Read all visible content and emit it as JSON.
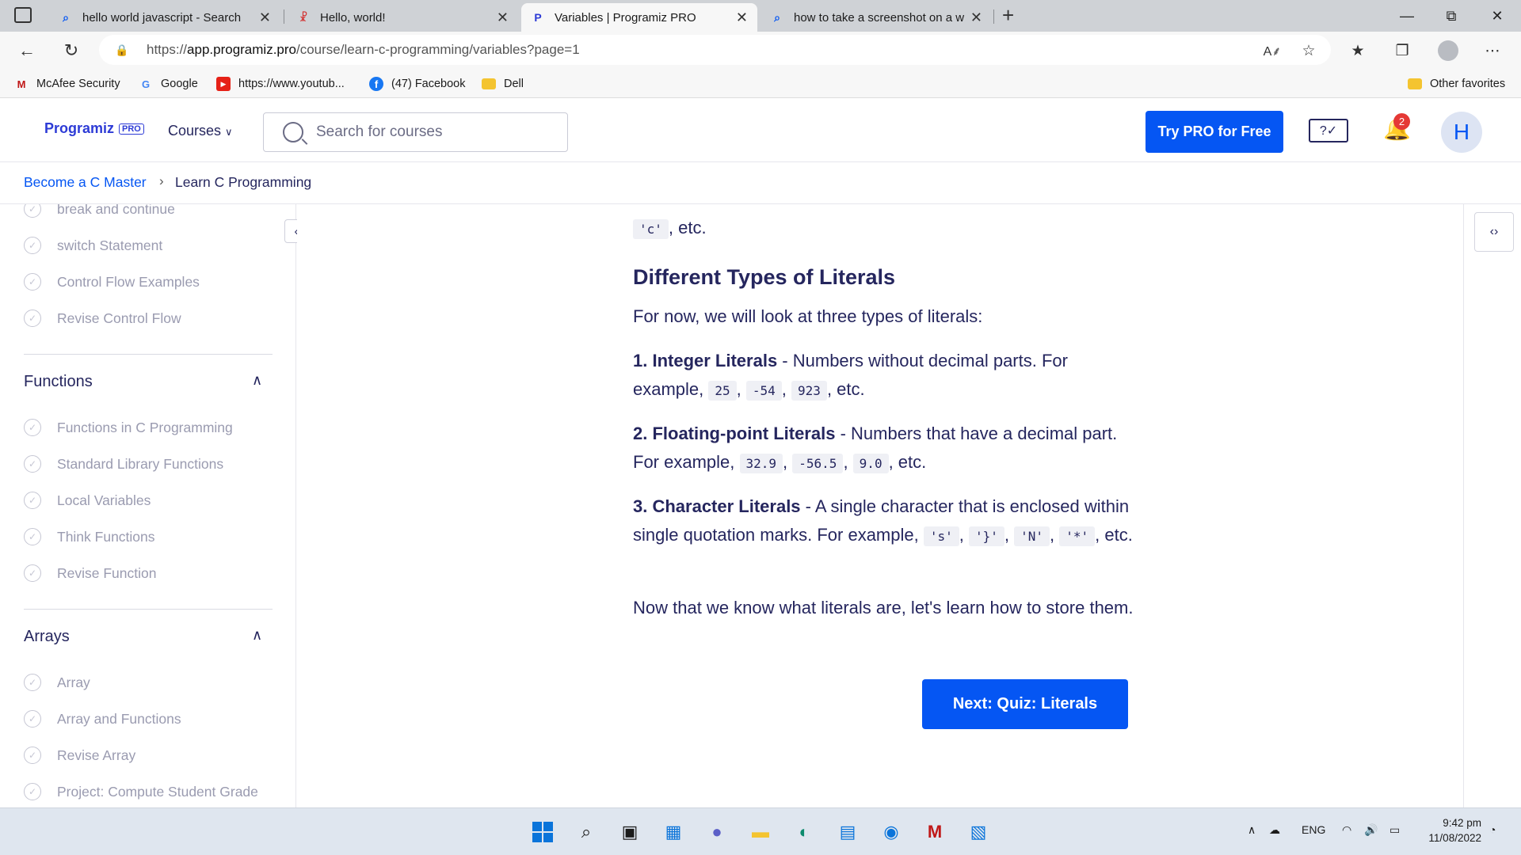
{
  "browser": {
    "tabs": [
      {
        "title": "hello world javascript - Search",
        "icon": "search-icon"
      },
      {
        "title": "Hello, world!",
        "icon": "site-icon"
      },
      {
        "title": "Variables | Programiz PRO",
        "icon": "programiz-icon"
      },
      {
        "title": "how to take a screenshot on a w",
        "icon": "search-icon"
      }
    ],
    "url_prefix": "https://",
    "url_host": "app.programiz.pro",
    "url_path": "/course/learn-c-programming/variables?page=1",
    "bookmarks": [
      {
        "label": "McAfee Security"
      },
      {
        "label": "Google"
      },
      {
        "label": "https://www.youtub..."
      },
      {
        "label": "(47) Facebook"
      },
      {
        "label": "Dell"
      }
    ],
    "other_favorites": "Other favorites"
  },
  "site": {
    "logo": "Programiz",
    "logo_badge": "PRO",
    "courses_label": "Courses",
    "search_placeholder": "Search for courses",
    "try_pro": "Try PRO for Free",
    "notification_count": "2",
    "avatar_initial": "H"
  },
  "breadcrumb": {
    "parent": "Become a C Master",
    "current": "Learn C Programming"
  },
  "sidebar": {
    "top_items": [
      "break and continue",
      "switch Statement",
      "Control Flow Examples",
      "Revise Control Flow"
    ],
    "sections": [
      {
        "title": "Functions",
        "items": [
          "Functions in C Programming",
          "Standard Library Functions",
          "Local Variables",
          "Think Functions",
          "Revise Function"
        ]
      },
      {
        "title": "Arrays",
        "items": [
          "Array",
          "Array and Functions",
          "Revise Array",
          "Project: Compute Student Grade"
        ]
      }
    ]
  },
  "content": {
    "partial_line_codes": [
      "'c'"
    ],
    "partial_line_suffix": ", etc.",
    "heading": "Different Types of Literals",
    "intro": "For now, we will look at three types of literals:",
    "items": [
      {
        "title": "1. Integer Literals",
        "desc": " - Numbers without decimal parts. For example, ",
        "codes": [
          "25",
          "-54",
          "923"
        ],
        "suffix": ", etc."
      },
      {
        "title": "2. Floating-point Literals",
        "desc": " - Numbers that have a decimal part. For example, ",
        "codes": [
          "32.9",
          "-56.5",
          "9.0"
        ],
        "suffix": ", etc."
      },
      {
        "title": "3. Character Literals",
        "desc": " - A single character that is enclosed within single quotation marks. For example, ",
        "codes": [
          "'s'",
          "'}'",
          "'N'",
          "'*'"
        ],
        "suffix": ", etc."
      }
    ],
    "outro": "Now that we know what literals are, let's learn how to store them.",
    "next_button": "Next: Quiz: Literals"
  },
  "taskbar": {
    "language": "ENG",
    "time": "9:42 pm",
    "date": "11/08/2022"
  },
  "colors": {
    "accent": "#0556f3",
    "text": "#25265e",
    "muted": "#9a9bb0",
    "badge": "#e53935"
  }
}
